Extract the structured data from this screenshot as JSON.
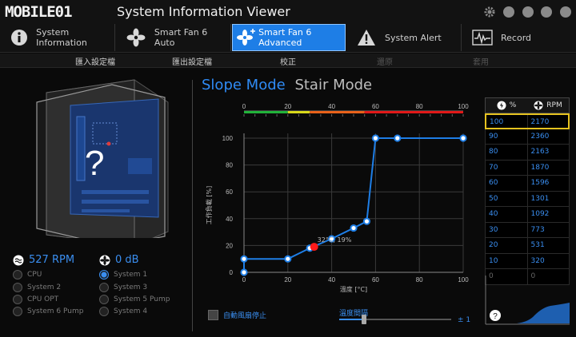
{
  "app": {
    "brand": "MOBILE01",
    "title": "System Information Viewer"
  },
  "window_controls": [
    "gear-icon",
    "minimize-icon",
    "maximize-icon",
    "close-icon"
  ],
  "tabs": [
    {
      "label": "System Information",
      "icon": "info-icon",
      "active": false
    },
    {
      "label": "Smart Fan 6 Auto",
      "icon": "fan-icon",
      "active": false
    },
    {
      "label": "Smart Fan 6 Advanced",
      "icon": "fan-plus-icon",
      "active": true
    },
    {
      "label": "System Alert",
      "icon": "warning-icon",
      "active": false
    },
    {
      "label": "Record",
      "icon": "waveform-icon",
      "active": false
    }
  ],
  "toolbar": {
    "import": "匯入設定檔",
    "export": "匯出設定檔",
    "calibrate": "校正",
    "reset": "還原",
    "apply": "套用"
  },
  "fan_status": {
    "rpm": "527 RPM",
    "noise": "0 dB",
    "unknown_mark": "?"
  },
  "fan_sources_left": [
    {
      "label": "CPU",
      "selected": false
    },
    {
      "label": "System 2",
      "selected": false
    },
    {
      "label": "CPU OPT",
      "selected": false
    },
    {
      "label": "System 6 Pump",
      "selected": false
    }
  ],
  "fan_sources_right": [
    {
      "label": "System 1",
      "selected": true
    },
    {
      "label": "System 3",
      "selected": false
    },
    {
      "label": "System 5 Pump",
      "selected": false
    },
    {
      "label": "System 4",
      "selected": false
    }
  ],
  "modes": {
    "slope": "Slope Mode",
    "stair": "Stair Mode",
    "active": "slope"
  },
  "chart_data": {
    "type": "line",
    "xlabel": "溫度 [°C]",
    "ylabel": "工作負載 [%]",
    "xlim": [
      0,
      100
    ],
    "ylim": [
      0,
      100
    ],
    "x_ticks": [
      0,
      20,
      40,
      60,
      80,
      100
    ],
    "y_ticks": [
      0,
      20,
      40,
      60,
      80,
      100
    ],
    "top_scale_ticks": [
      0,
      20,
      40,
      60,
      80,
      100
    ],
    "points": [
      {
        "x": 0,
        "y": 0
      },
      {
        "x": 0,
        "y": 10
      },
      {
        "x": 20,
        "y": 10
      },
      {
        "x": 30,
        "y": 18
      },
      {
        "x": 40,
        "y": 25
      },
      {
        "x": 50,
        "y": 33
      },
      {
        "x": 56,
        "y": 38
      },
      {
        "x": 60,
        "y": 100
      },
      {
        "x": 70,
        "y": 100
      },
      {
        "x": 100,
        "y": 100
      }
    ],
    "current_point": {
      "x": 32,
      "y": 19
    },
    "current_label": "32°C, 19%",
    "series_color": "#1e7ee6",
    "current_color": "#ff1a1a",
    "top_gradient": [
      {
        "from": 0,
        "to": 20,
        "color": "#22b33a"
      },
      {
        "from": 20,
        "to": 30,
        "color": "#d8d81a"
      },
      {
        "from": 30,
        "to": 55,
        "color": "#e8621a"
      },
      {
        "from": 55,
        "to": 100,
        "color": "#e01818"
      }
    ]
  },
  "rpm_table": {
    "header_percent": "%",
    "header_rpm": "RPM",
    "rows": [
      {
        "percent": "100",
        "rpm": "2170",
        "selected": true
      },
      {
        "percent": "90",
        "rpm": "2360"
      },
      {
        "percent": "80",
        "rpm": "2163"
      },
      {
        "percent": "70",
        "rpm": "1870"
      },
      {
        "percent": "60",
        "rpm": "1596"
      },
      {
        "percent": "50",
        "rpm": "1301"
      },
      {
        "percent": "40",
        "rpm": "1092"
      },
      {
        "percent": "30",
        "rpm": "773"
      },
      {
        "percent": "20",
        "rpm": "531"
      },
      {
        "percent": "10",
        "rpm": "320"
      },
      {
        "percent": "0",
        "rpm": "0"
      }
    ]
  },
  "controls": {
    "auto_stop_label": "自動風扇停止",
    "interval_label": "溫度間隔",
    "interval_value": "± 1",
    "interval_position": 0.22
  },
  "colors": {
    "accent": "#1e7ee6",
    "highlight": "#e5c21f"
  }
}
